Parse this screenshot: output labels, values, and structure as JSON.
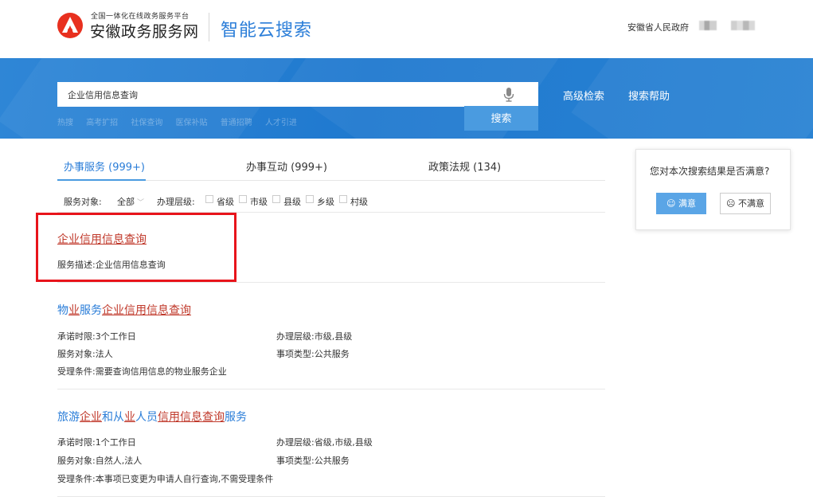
{
  "header": {
    "platform_small": "全国一体化在线政务服务平台",
    "platform_name": "安徽政务服务网",
    "product_name": "智能云搜索",
    "gov_name": "安徽省人民政府"
  },
  "search": {
    "query": "企业信用信息查询",
    "button": "搜索",
    "advanced": "高级检索",
    "help": "搜索帮助",
    "hot_links": [
      "热搜",
      "高考扩招",
      "社保查询",
      "医保补贴",
      "普通招聘",
      "人才引进"
    ]
  },
  "tabs": [
    {
      "label": "办事服务 (999+)",
      "active": true
    },
    {
      "label": "办事互动 (999+)",
      "active": false
    },
    {
      "label": "政策法规 (134)",
      "active": false
    }
  ],
  "filters": {
    "target_label": "服务对象:",
    "target_value": "全部",
    "level_label": "办理层级:",
    "levels": [
      "省级",
      "市级",
      "县级",
      "乡级",
      "村级"
    ]
  },
  "results": [
    {
      "title": "企业信用信息查询",
      "desc_label": "服务描述:",
      "desc": "企业信用信息查询"
    },
    {
      "title_parts": [
        {
          "text": "物",
          "hl": false
        },
        {
          "text": "业",
          "hl": true
        },
        {
          "text": "服务",
          "hl": false
        },
        {
          "text": "企业信用信息查询",
          "hl": true
        }
      ],
      "time": "承诺时限:3个工作日",
      "level": "办理层级:市级,县级",
      "target": "服务对象:法人",
      "type": "事项类型:公共服务",
      "condition": "受理条件:需要查询信用信息的物业服务企业"
    },
    {
      "title_parts": [
        {
          "text": "旅游",
          "hl": false
        },
        {
          "text": "企业",
          "hl": true
        },
        {
          "text": "和从",
          "hl": false
        },
        {
          "text": "业",
          "hl": true
        },
        {
          "text": "人员",
          "hl": false
        },
        {
          "text": "信用信息查询",
          "hl": true
        },
        {
          "text": "服务",
          "hl": false
        }
      ],
      "time": "承诺时限:1个工作日",
      "level": "办理层级:省级,市级,县级",
      "target": "服务对象:自然人,法人",
      "type": "事项类型:公共服务",
      "condition": "受理条件:本事项已变更为申请人自行查询,不需受理条件"
    }
  ],
  "feedback": {
    "question": "您对本次搜索结果是否满意?",
    "yes": "满意",
    "no": "不满意"
  }
}
